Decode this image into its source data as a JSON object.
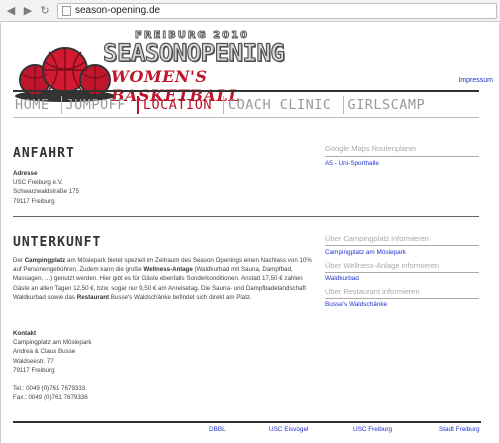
{
  "browser": {
    "url": "season-opening.de"
  },
  "logo": {
    "year": "FREIBURG 2010",
    "title": "SEASONOPENING",
    "subtitle": "WOMEN'S BASKETBALL"
  },
  "header": {
    "impressum": "Impressum"
  },
  "nav": [
    "HOME",
    "JUMPOFF",
    "LOCATION",
    "COACH CLINIC",
    "GIRLSCAMP"
  ],
  "anfahrt": {
    "title": "ANFAHRT",
    "label": "Adresse",
    "lines": [
      "USC Freiburg e.V.",
      "Schwarzwaldstraße 175",
      "79117 Freiburg"
    ]
  },
  "side_maps": {
    "heading": "Google Maps Routenplaner",
    "link": "A5 - Uni-Sporthalle"
  },
  "unterkunft": {
    "title": "UNTERKUNFT",
    "p1": {
      "a": "Der ",
      "b1": "Campingplatz",
      "c": " am Möslepark bietet speziell im Zeitraum des Season Openings einen Nachlass von 10% auf Personengebühren. Zudem kann die große ",
      "b2": "Wellness-Anlage",
      "d": " (Waldkurbad mit Sauna, Dampfbad, Massagen, ...) genutzt werden. Hier gibt es für Gäste ebenfalls Sonderkonditionen. Anstatt 17,50 € zahlen Gäste an allen Tagen 12,50 €, bzw. sogar nur 9,50 € am Anreisetag. Die Sauna- und Dampfbadelandschaft Waldkurbad sowie das ",
      "b3": "Restaurant",
      "e": " Busse's Waldschänke befindet sich direkt am Platz."
    },
    "kontakt_label": "Kontakt",
    "kontakt_lines": [
      "Campingplatz am Möslepark",
      "Andrea & Claus Busse",
      "Waldseestr. 77",
      "79117 Freiburg"
    ],
    "phone": "Tel.: 0049 (0)761 7679333",
    "fax": "Fax.: 0049 (0)761 7679336"
  },
  "side_info": [
    {
      "heading": "Über Campingplatz informieren",
      "link": "Campingplatz am Möslepark"
    },
    {
      "heading": "Über Wellness-Anlage informieren",
      "link": "Waldkurbad"
    },
    {
      "heading": "Über Restaurant informieren",
      "link": "Busse's Waldschänke"
    }
  ],
  "footer": [
    "DBBL",
    "USC Eisvögel",
    "USC Freiburg",
    "Stadt Freiburg"
  ],
  "colors": {
    "accent": "#b8142a",
    "link": "#2233cc"
  }
}
